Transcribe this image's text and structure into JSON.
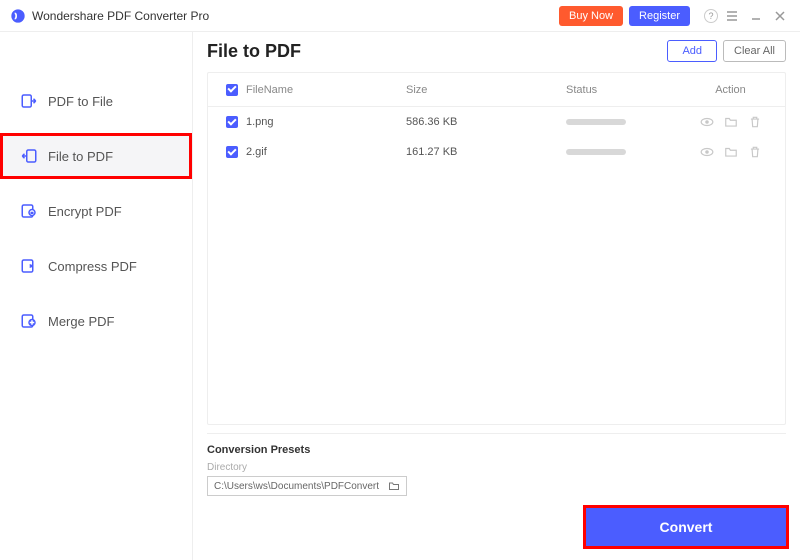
{
  "titlebar": {
    "app_title": "Wondershare PDF Converter Pro",
    "buy": "Buy Now",
    "register": "Register"
  },
  "sidebar": {
    "items": [
      {
        "label": "PDF to File"
      },
      {
        "label": "File to PDF"
      },
      {
        "label": "Encrypt PDF"
      },
      {
        "label": "Compress PDF"
      },
      {
        "label": "Merge PDF"
      }
    ]
  },
  "page": {
    "title": "File to PDF",
    "add": "Add",
    "clear": "Clear All"
  },
  "table": {
    "headers": {
      "name": "FileName",
      "size": "Size",
      "status": "Status",
      "action": "Action"
    },
    "rows": [
      {
        "name": "1.png",
        "size": "586.36 KB"
      },
      {
        "name": "2.gif",
        "size": "161.27 KB"
      }
    ]
  },
  "presets": {
    "title": "Conversion Presets",
    "dir_label": "Directory",
    "dir_value": "C:\\Users\\ws\\Documents\\PDFConvert"
  },
  "convert": "Convert"
}
